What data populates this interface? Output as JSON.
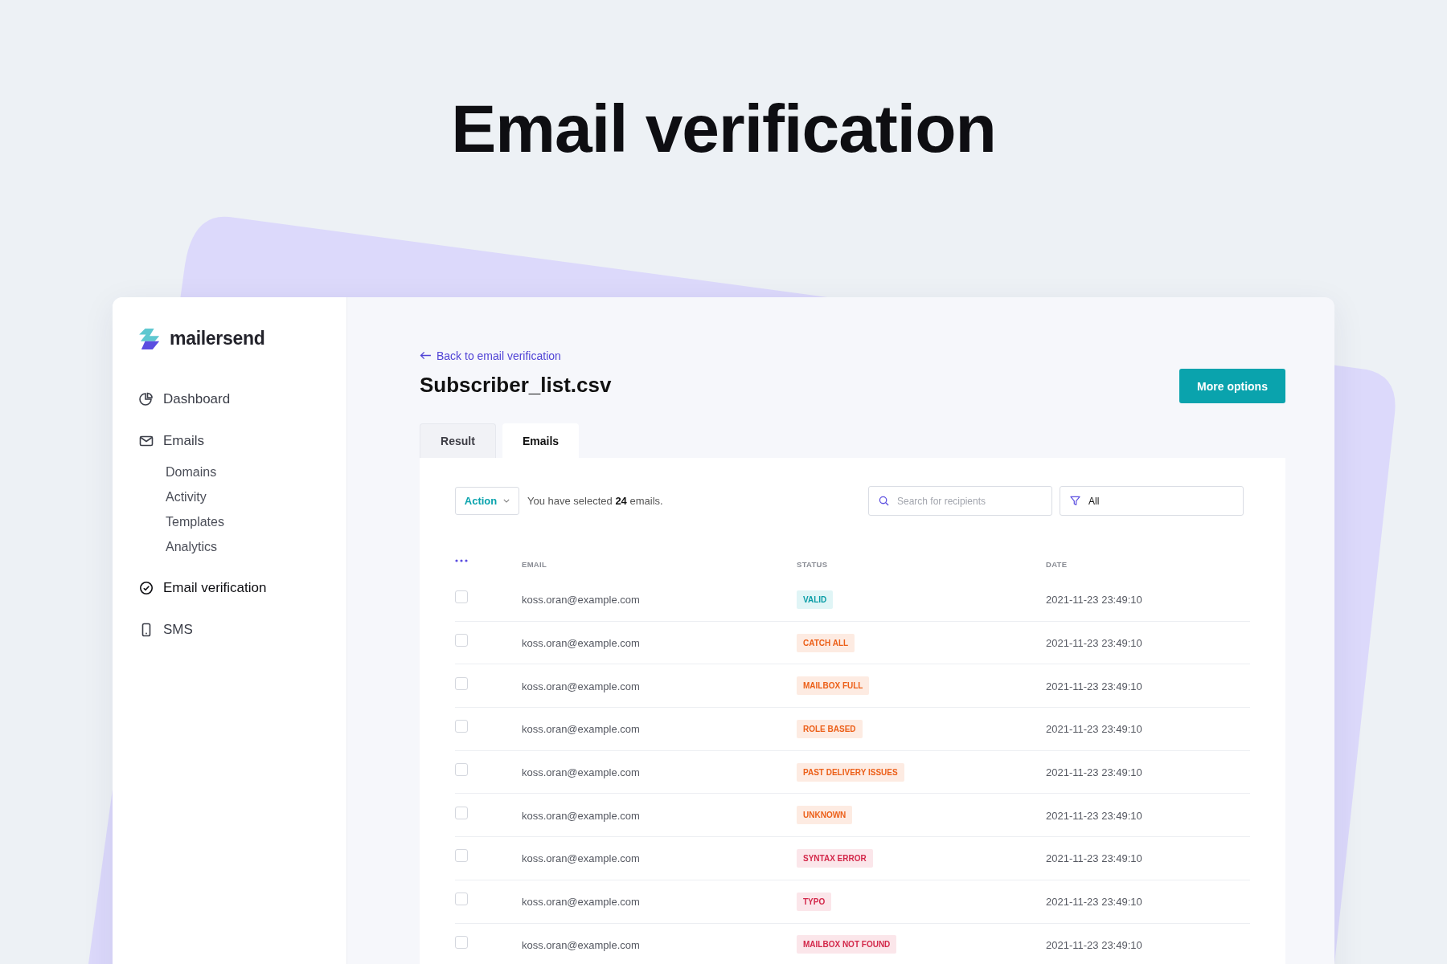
{
  "headline": "Email verification",
  "sidebar": {
    "logo": "mailersend",
    "items": [
      {
        "label": "Dashboard",
        "selected": false
      },
      {
        "label": "Emails",
        "selected": false,
        "children": [
          {
            "label": "Domains"
          },
          {
            "label": "Activity"
          },
          {
            "label": "Templates"
          },
          {
            "label": "Analytics"
          }
        ]
      },
      {
        "label": "Email verification",
        "selected": true
      },
      {
        "label": "SMS",
        "selected": false
      }
    ]
  },
  "back_link": "Back to email verification",
  "title": "Subscriber_list.csv",
  "more_button": "More options",
  "tabs": [
    {
      "label": "Result",
      "selected": false
    },
    {
      "label": "Emails",
      "selected": true
    }
  ],
  "toolbar": {
    "action": "Action",
    "selection_text": "You have selected **24** emails.",
    "search": {
      "placeholder": "Search for recipients"
    },
    "filter": "All"
  },
  "table": {
    "columns": [
      "EMAIL",
      "STATUS",
      "DATE"
    ],
    "rows": [
      {
        "checked": false,
        "email": "koss.oran@example.com",
        "status": "VALID",
        "kind": "valid",
        "date": "2021-11-23 23:49:10"
      },
      {
        "checked": false,
        "email": "koss.oran@example.com",
        "status": "CATCH ALL",
        "kind": "warning",
        "date": "2021-11-23 23:49:10"
      },
      {
        "checked": false,
        "email": "koss.oran@example.com",
        "status": "MAILBOX FULL",
        "kind": "warning",
        "date": "2021-11-23 23:49:10"
      },
      {
        "checked": false,
        "email": "koss.oran@example.com",
        "status": "ROLE BASED",
        "kind": "warning",
        "date": "2021-11-23 23:49:10"
      },
      {
        "checked": false,
        "email": "koss.oran@example.com",
        "status": "PAST DELIVERY ISSUES",
        "kind": "warning",
        "date": "2021-11-23 23:49:10"
      },
      {
        "checked": false,
        "email": "koss.oran@example.com",
        "status": "UNKNOWN",
        "kind": "warning",
        "date": "2021-11-23 23:49:10"
      },
      {
        "checked": false,
        "email": "koss.oran@example.com",
        "status": "SYNTAX ERROR",
        "kind": "error",
        "date": "2021-11-23 23:49:10"
      },
      {
        "checked": false,
        "email": "koss.oran@example.com",
        "status": "TYPO",
        "kind": "error",
        "date": "2021-11-23 23:49:10"
      },
      {
        "checked": false,
        "email": "koss.oran@example.com",
        "status": "MAILBOX NOT FOUND",
        "kind": "error",
        "date": "2021-11-23 23:49:10"
      }
    ]
  }
}
